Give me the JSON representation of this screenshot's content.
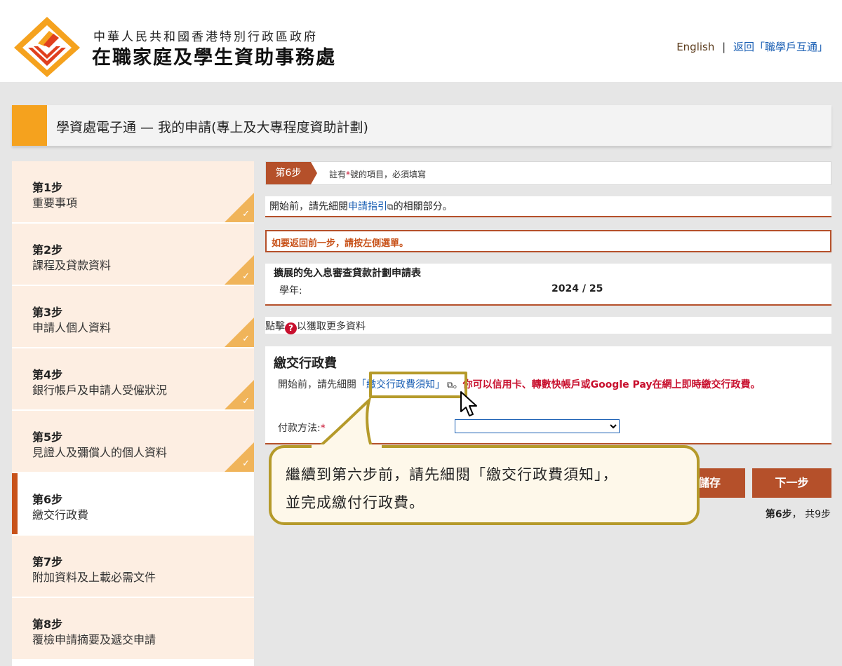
{
  "header": {
    "org_line1": "中華人民共和國香港特別行政區政府",
    "org_line2": "在職家庭及學生資助事務處",
    "english_link": "English",
    "separator": "|",
    "back_link": "返回「職學戶互通」"
  },
  "title": "學資處電子通 — 我的申請(專上及大專程度資助計劃)",
  "sidebar": {
    "items": [
      {
        "num": "第1步",
        "label": "重要事項",
        "done": true
      },
      {
        "num": "第2步",
        "label": "課程及貸款資料",
        "done": true
      },
      {
        "num": "第3步",
        "label": "申請人個人資料",
        "done": true
      },
      {
        "num": "第4步",
        "label": "銀行帳戶及申請人受僱狀況",
        "done": true
      },
      {
        "num": "第5步",
        "label": "見證人及彌償人的個人資料",
        "done": true
      },
      {
        "num": "第6步",
        "label": "繳交行政費",
        "done": false
      },
      {
        "num": "第7步",
        "label": "附加資料及上載必需文件",
        "done": false
      },
      {
        "num": "第8步",
        "label": "覆檢申請摘要及遞交申請",
        "done": false
      }
    ],
    "check_glyph": "✓"
  },
  "main": {
    "step_tag": "第6步",
    "note_pre": "註有",
    "note_star": "*",
    "note_post": "號的項目，必須填寫",
    "guide_pre": "開始前，請先細閱",
    "guide_link": "申請指引",
    "guide_post": "的相關部分。",
    "warning": "如要返回前一步，請按左側選單。",
    "form_title": "擴展的免入息審查貸款計劃申請表",
    "year_label": "學年:",
    "year_value": "2024 / 25",
    "more_pre": "點擊",
    "more_post": "以獲取更多資料",
    "fee_heading": "繳交行政費",
    "fee_pre": "開始前，請先細閱",
    "fee_link": "「繳交行政費須知」",
    "fee_dot": "。",
    "fee_red": "你可以信用卡、轉數快帳戶或Google Pay在網上即時繳交行政費。",
    "payment_label": "付款方法:",
    "payment_value": "",
    "save_button": "儲存",
    "next_button": "下一步",
    "page_current": "第6步",
    "page_total": "，  共9步"
  },
  "callout": {
    "line1": "繼續到第六步前，請先細閱「繳交行政費須知」，",
    "line2": "並完成繳付行政費。"
  },
  "colors": {
    "accent_orange": "#f5a21e",
    "brown": "#b5502a",
    "link_blue": "#1a5fb4",
    "red": "#c8102e",
    "callout_border": "#b59a2a"
  }
}
